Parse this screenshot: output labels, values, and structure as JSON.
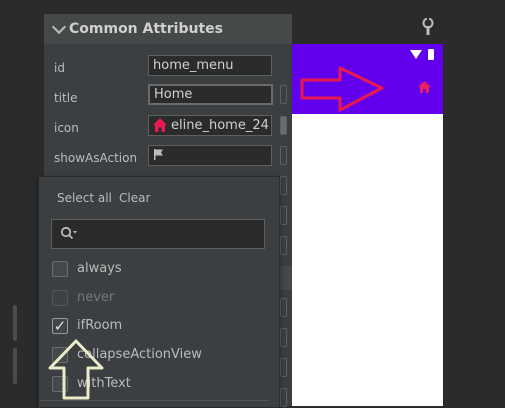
{
  "section": {
    "title": "Common Attributes"
  },
  "attributes": [
    {
      "label": "id",
      "value": "home_menu"
    },
    {
      "label": "title",
      "value": "Home"
    },
    {
      "label": "icon",
      "value": "eline_home_24"
    },
    {
      "label": "showAsAction",
      "value": ""
    }
  ],
  "popup": {
    "select_all": "Select all",
    "clear": "Clear",
    "options": [
      {
        "label": "always",
        "checked": false,
        "enabled": true
      },
      {
        "label": "never",
        "checked": false,
        "enabled": false
      },
      {
        "label": "ifRoom",
        "checked": true,
        "enabled": true
      },
      {
        "label": "collapseActionView",
        "checked": false,
        "enabled": true
      },
      {
        "label": "withText",
        "checked": false,
        "enabled": true
      }
    ]
  },
  "preview": {
    "toolbar_color": "#6200ee",
    "action_icon": "home-icon",
    "action_icon_color": "#e91e63",
    "arrow_color": "#e8194f"
  },
  "annotation": {
    "up_arrow_color": "#e9ebc9"
  },
  "icons": {
    "collapse": "chevron-down-icon",
    "tool": "wrench-icon",
    "search": "search-icon",
    "flag": "flag-icon"
  }
}
